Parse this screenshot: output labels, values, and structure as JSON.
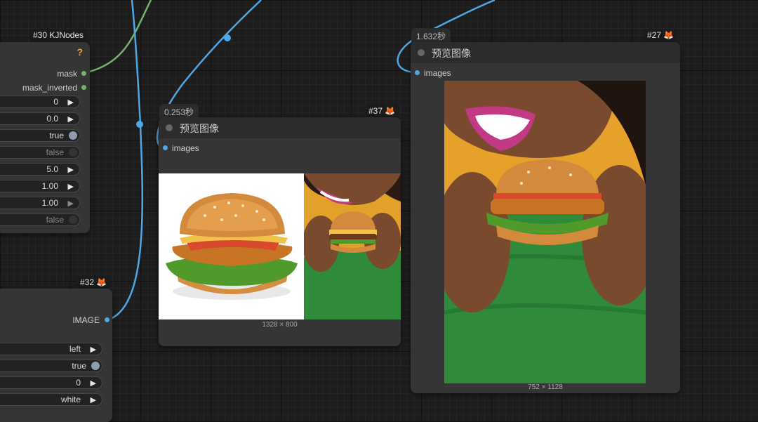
{
  "colors": {
    "image_link": "#4ea8e6",
    "mask_link": "#72b56a",
    "canvas_bg": "#1d1d1d",
    "node_bg": "#353535"
  },
  "kjnodes": {
    "badge": "#30 KJNodes",
    "help_icon": "?",
    "outputs": [
      "mask",
      "mask_inverted"
    ],
    "widgets": [
      {
        "value": "0",
        "kind": "number"
      },
      {
        "value": "0.0",
        "kind": "number"
      },
      {
        "value": "true",
        "kind": "toggle_on"
      },
      {
        "value": "false",
        "kind": "toggle_off"
      },
      {
        "value": "5.0",
        "kind": "number"
      },
      {
        "value": "1.00",
        "kind": "number"
      },
      {
        "value": "1.00",
        "kind": "number"
      },
      {
        "value": "false",
        "kind": "toggle_off"
      }
    ]
  },
  "node32": {
    "badge": "#32 🦊",
    "output": "IMAGE",
    "widgets": [
      {
        "value": "left",
        "kind": "combo"
      },
      {
        "value": "true",
        "kind": "toggle_on"
      },
      {
        "value": "0",
        "kind": "number"
      },
      {
        "value": "white",
        "kind": "combo"
      }
    ]
  },
  "node37": {
    "badge": "#37 🦊",
    "time": "0.253秒",
    "title": "预览图像",
    "input": "images",
    "image_caption": "1328 × 800"
  },
  "node27": {
    "badge": "#27 🦊",
    "time": "1.632秒",
    "title": "预览图像",
    "input": "images",
    "image_caption": "752 × 1128"
  }
}
